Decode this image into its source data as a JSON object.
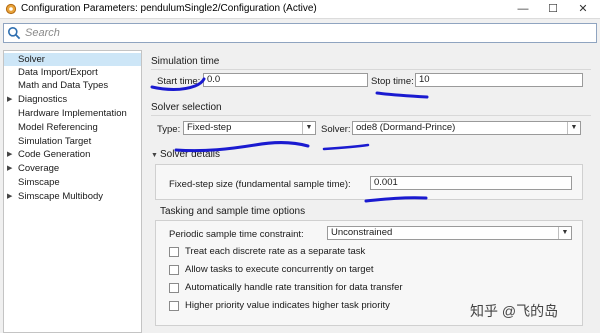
{
  "window": {
    "title": "Configuration Parameters: pendulumSingle2/Configuration (Active)",
    "minimize": "—",
    "maximize": "☐",
    "close": "✕"
  },
  "search": {
    "placeholder": "Search"
  },
  "sidebar": {
    "items": [
      {
        "label": "Solver",
        "expandable": false,
        "selected": true
      },
      {
        "label": "Data Import/Export",
        "expandable": false
      },
      {
        "label": "Math and Data Types",
        "expandable": false
      },
      {
        "label": "Diagnostics",
        "expandable": true
      },
      {
        "label": "Hardware Implementation",
        "expandable": false
      },
      {
        "label": "Model Referencing",
        "expandable": false
      },
      {
        "label": "Simulation Target",
        "expandable": false
      },
      {
        "label": "Code Generation",
        "expandable": true
      },
      {
        "label": "Coverage",
        "expandable": true
      },
      {
        "label": "Simscape",
        "expandable": false
      },
      {
        "label": "Simscape Multibody",
        "expandable": true
      }
    ]
  },
  "simulation_time": {
    "heading": "Simulation time",
    "start_label": "Start time:",
    "start_value": "0.0",
    "stop_label": "Stop time:",
    "stop_value": "10"
  },
  "solver_selection": {
    "heading": "Solver selection",
    "type_label": "Type:",
    "type_value": "Fixed-step",
    "solver_label": "Solver:",
    "solver_value": "ode8 (Dormand-Prince)"
  },
  "solver_details": {
    "heading": "Solver details",
    "step_size_label": "Fixed-step size (fundamental sample time):",
    "step_size_value": "0.001",
    "tasking_heading": "Tasking and sample time options",
    "constraint_label": "Periodic sample time constraint:",
    "constraint_value": "Unconstrained",
    "options": [
      {
        "label": "Treat each discrete rate as a separate task",
        "checked": false
      },
      {
        "label": "Allow tasks to execute concurrently on target",
        "checked": false
      },
      {
        "label": "Automatically handle rate transition for data transfer",
        "checked": false
      },
      {
        "label": "Higher priority value indicates higher task priority",
        "checked": false
      }
    ]
  },
  "icons": {
    "app": "simulink-gear-icon",
    "search": "search-icon",
    "expand": "triangle-right-icon",
    "collapse": "triangle-down-icon",
    "dropdown": "chevron-down-icon"
  },
  "colors": {
    "selection": "#cde6f7",
    "annotation_ink": "#1a1ad0",
    "search_border": "#8fa4c0"
  },
  "watermark": "知乎 @飞的岛"
}
